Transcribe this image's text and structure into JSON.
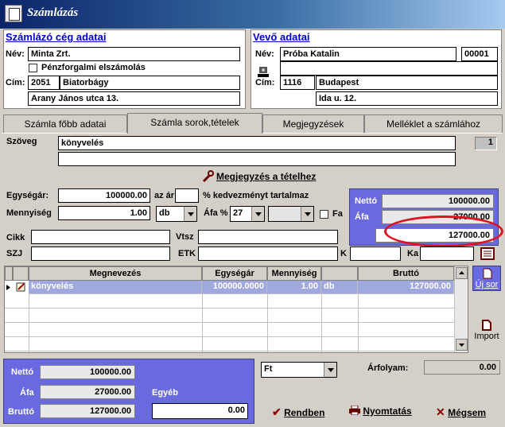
{
  "window": {
    "title": "Számlázás"
  },
  "seller": {
    "title": "Számlázó cég adatai",
    "name_label": "Név:",
    "name": "Minta Zrt.",
    "cash_label": "Pénzforgalmi elszámolás",
    "address_label": "Cím:",
    "zip": "2051",
    "city": "Biatorbágy",
    "street": "Arany János utca 13."
  },
  "buyer": {
    "title": "Vevő adatai",
    "name_label": "Név:",
    "name": "Próba Katalin",
    "code": "00001",
    "address_label": "Cím:",
    "zip": "1116",
    "city": "Budapest",
    "street": "Ida u. 12."
  },
  "tabs": [
    {
      "label": "Számla főbb adatai"
    },
    {
      "label": "Számla sorok,tételek"
    },
    {
      "label": "Megjegyzések"
    },
    {
      "label": "Melléklet a számlához"
    }
  ],
  "item": {
    "text_label": "Szöveg",
    "text": "könyvelés",
    "counter": "1",
    "note_button": "Megjegyzés a tételhez",
    "unit_price_label": "Egységár:",
    "unit_price": "100000.00",
    "price_suffix": "az ár",
    "discount_label": "% kedvezményt tartalmaz",
    "qty_label": "Mennyiség",
    "qty": "1.00",
    "unit": "db",
    "vat_label": "Áfa %",
    "vat": "27",
    "fa_label": "Fa",
    "net_label": "Nettó",
    "net": "100000.00",
    "vat_amount_label": "Áfa",
    "vat_amount": "27000.00",
    "gross": "127000.00",
    "cikk_label": "Cikk",
    "vtsz_label": "Vtsz",
    "szj_label": "SZJ",
    "etk_label": "ETK",
    "k_label": "K",
    "ka_label": "Ka"
  },
  "grid": {
    "headers": [
      "Megnevezés",
      "Egységár",
      "Mennyiség",
      "",
      "Bruttó"
    ],
    "rows": [
      {
        "name": "könyvelés",
        "unit_price": "100000.0000",
        "qty": "1.00",
        "unit": "db",
        "gross": "127000.00"
      }
    ]
  },
  "side": {
    "new_row": "Új sor",
    "import": "Import"
  },
  "totals": {
    "net_label": "Nettó",
    "net": "100000.00",
    "vat_label": "Áfa",
    "vat": "27000.00",
    "gross_label": "Bruttó",
    "gross": "127000.00",
    "other_label": "Egyéb",
    "other": "0.00",
    "currency": "Ft",
    "rate_label": "Árfolyam:",
    "rate": "0.00"
  },
  "buttons": {
    "ok": "Rendben",
    "print": "Nyomtatás",
    "cancel": "Mégsem"
  },
  "colors": {
    "accent_blue": "#6a6ae0",
    "highlight_red": "#e01020",
    "link_blue": "#0000cc"
  }
}
